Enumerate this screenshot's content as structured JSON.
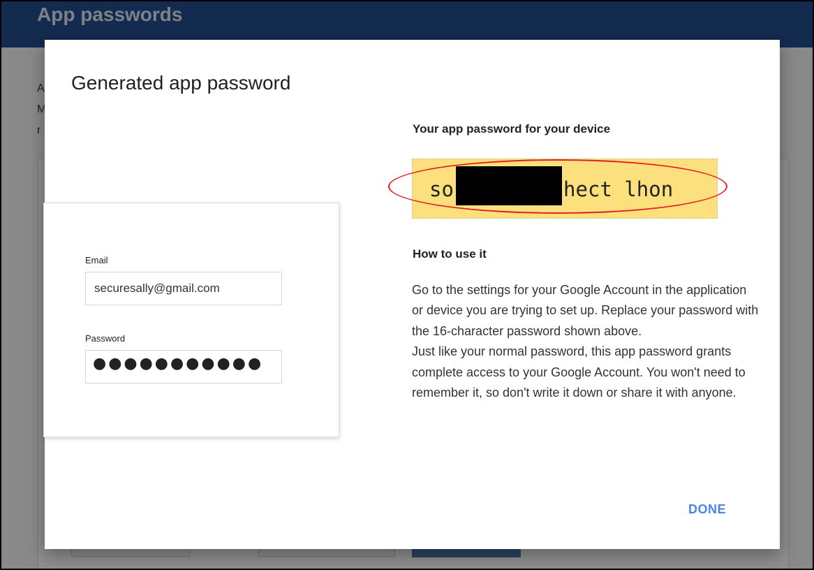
{
  "page": {
    "title": "App passwords",
    "intro_fragments": [
      "A",
      "M",
      "r"
    ]
  },
  "dialog": {
    "title": "Generated app password",
    "sample_signin": {
      "email_label": "Email",
      "email_value": "securesally@gmail.com",
      "password_label": "Password",
      "password_mask": "●●●●●●●●●●●"
    },
    "password_heading": "Your app password for your device",
    "password_value": "so         hect lhon",
    "howto_heading": "How to use it",
    "howto_paragraphs": [
      "Go to the settings for your Google Account in the application or device you are trying to set up. Replace your password with the 16-character password shown above.",
      "Just like your normal password, this app password grants complete access to your Google Account. You won't need to remember it, so don't write it down or share it with anyone."
    ],
    "done_label": "DONE"
  },
  "colors": {
    "header_blue": "#214a88",
    "password_highlight": "#fde07e",
    "annotation_red": "#e61e1e",
    "done_blue": "#4a86e8"
  }
}
